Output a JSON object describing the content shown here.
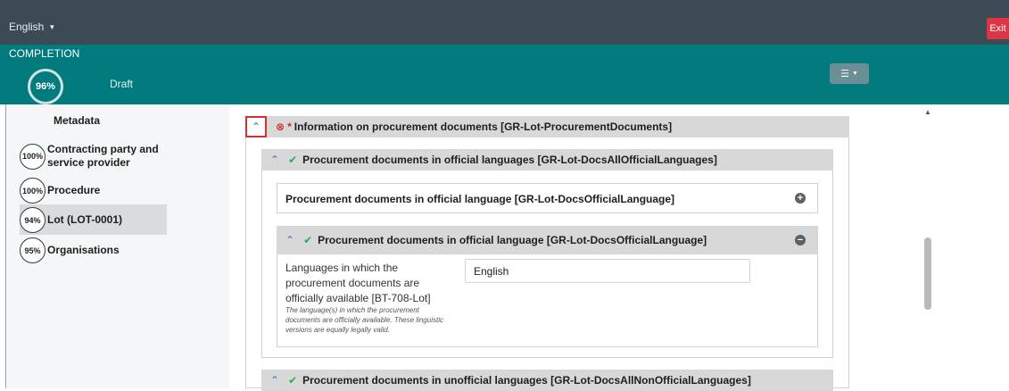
{
  "topbar": {
    "language": "English",
    "exit_label": "Exit"
  },
  "status": {
    "completion_label": "COMPLETION",
    "completion_pct": "96%",
    "state": "Draft"
  },
  "sidebar": {
    "items": [
      {
        "label": "Metadata",
        "pct": ""
      },
      {
        "label": "Contracting party and service provider",
        "label_line1": "Contracting party and",
        "label_line2": "service provider",
        "pct": "100%"
      },
      {
        "label": "Procedure",
        "pct": "100%"
      },
      {
        "label": "Lot (LOT-0001)",
        "pct": "94%",
        "active": true
      },
      {
        "label": "Organisations",
        "pct": "95%"
      }
    ]
  },
  "main": {
    "section": {
      "title": "Information on procurement documents  [GR-Lot-ProcurementDocuments]",
      "required": "*",
      "status": "error"
    },
    "subsection": {
      "title": "Procurement documents in official languages  [GR-Lot-DocsAllOfficialLanguages]",
      "status": "ok"
    },
    "collapsed_group": {
      "title": "Procurement documents in official language  [GR-Lot-DocsOfficialLanguage]"
    },
    "expanded_group": {
      "title": "Procurement documents in official language  [GR-Lot-DocsOfficialLanguage]",
      "status": "ok",
      "field": {
        "label": "Languages in which the procurement documents are officially available [BT-708-Lot]",
        "help": "The language(s) in which the procurement documents are officially available. These linguistic versions are equally legally valid.",
        "value": "English"
      }
    },
    "next_subsection": {
      "title": "Procurement documents in unofficial languages  [GR-Lot-DocsAllNonOfficialLanguages]",
      "status": "ok"
    }
  },
  "colors": {
    "topbar": "#3b4a54",
    "status_bar": "#017b7e",
    "exit": "#dc3545",
    "ok": "#2eaa4a",
    "error": "#cc2d2d",
    "link": "#3b6fb6"
  }
}
